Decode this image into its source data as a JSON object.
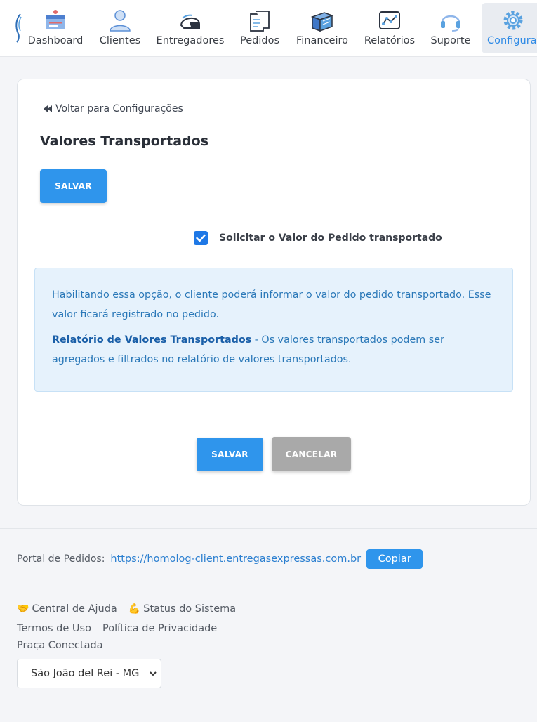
{
  "nav": {
    "items": [
      {
        "label": "Dashboard",
        "icon": "dashboard-icon"
      },
      {
        "label": "Clientes",
        "icon": "user-icon"
      },
      {
        "label": "Entregadores",
        "icon": "helmet-icon"
      },
      {
        "label": "Pedidos",
        "icon": "receipt-icon"
      },
      {
        "label": "Financeiro",
        "icon": "money-icon"
      },
      {
        "label": "Relatórios",
        "icon": "chart-icon"
      },
      {
        "label": "Suporte",
        "icon": "headset-icon"
      },
      {
        "label": "Configura",
        "icon": "gear-icon"
      }
    ]
  },
  "card": {
    "back_label": "Voltar para Configurações",
    "title": "Valores Transportados",
    "save_label": "SALVAR",
    "checkbox_label": "Solicitar o Valor do Pedido transportado",
    "checkbox_checked": true,
    "info_text": "Habilitando essa opção, o cliente poderá informar o valor do pedido transportado. Esse valor ficará registrado no pedido.",
    "info_link": "Relatório de Valores Transportados",
    "info_text2": " - Os valores transportados podem ser agregados e filtrados no relatório de valores transportados.",
    "save_bottom_label": "SALVAR",
    "cancel_label": "CANCELAR"
  },
  "footer": {
    "portal_label": "Portal de Pedidos:",
    "portal_url": "https://homolog-client.entregasexpressas.com.br",
    "copy_label": "Copiar",
    "help_label": "Central de Ajuda",
    "status_label": "Status do Sistema",
    "terms_label": "Termos de Uso",
    "privacy_label": "Política de Privacidade",
    "praca_label": "Praça Conectada",
    "praca_value": "São João del Rei - MG"
  },
  "colors": {
    "accent": "#2f95ec",
    "active_nav": "#2e8ae6",
    "info_bg": "#e6f2fc"
  }
}
